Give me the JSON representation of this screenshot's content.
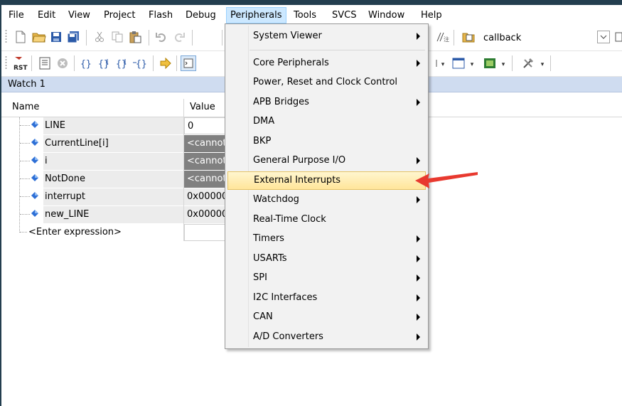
{
  "menubar": {
    "items": [
      "File",
      "Edit",
      "View",
      "Project",
      "Flash",
      "Debug",
      "Peripherals",
      "Tools",
      "SVCS",
      "Window",
      "Help"
    ],
    "active": "Peripherals"
  },
  "toolbar": {
    "search_text": "callback",
    "rst_label": "RST"
  },
  "watch": {
    "title": "Watch 1",
    "headers": {
      "name": "Name",
      "value": "Value"
    },
    "rows": [
      {
        "name": "LINE",
        "value": "0"
      },
      {
        "name": "CurrentLine[i]",
        "value": "<cannot"
      },
      {
        "name": "i",
        "value": "<cannot"
      },
      {
        "name": "NotDone",
        "value": "<cannot"
      },
      {
        "name": "interrupt",
        "value": "0x00000"
      },
      {
        "name": "new_LINE",
        "value": "0x00000"
      }
    ],
    "enter_expression": "<Enter expression>"
  },
  "dropdown": {
    "items": [
      {
        "label": "System Viewer",
        "submenu": true
      },
      {
        "label": "Core Peripherals",
        "submenu": true
      },
      {
        "label": "Power, Reset and Clock Control",
        "submenu": false
      },
      {
        "label": "APB Bridges",
        "submenu": true
      },
      {
        "label": "DMA",
        "submenu": false
      },
      {
        "label": "BKP",
        "submenu": false
      },
      {
        "label": "General Purpose I/O",
        "submenu": true
      },
      {
        "label": "External Interrupts",
        "submenu": false
      },
      {
        "label": "Watchdog",
        "submenu": true
      },
      {
        "label": "Real-Time Clock",
        "submenu": false
      },
      {
        "label": "Timers",
        "submenu": true
      },
      {
        "label": "USARTs",
        "submenu": true
      },
      {
        "label": "SPI",
        "submenu": true
      },
      {
        "label": "I2C Interfaces",
        "submenu": true
      },
      {
        "label": "CAN",
        "submenu": true
      },
      {
        "label": "A/D Converters",
        "submenu": true
      }
    ],
    "highlighted": "External Interrupts"
  },
  "colors": {
    "highlight": "#ffe59a",
    "annotation_arrow": "#e8392f",
    "watch_title_bg": "#cfdcf0"
  }
}
